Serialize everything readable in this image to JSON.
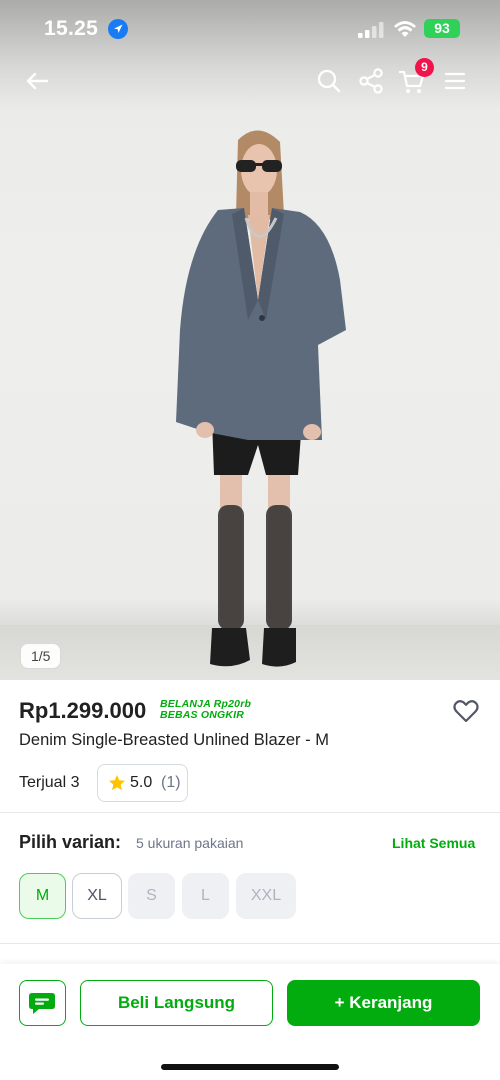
{
  "status_bar": {
    "time": "15.25",
    "battery": "93",
    "icons": [
      "location-arrow-icon",
      "cellular-signal-icon",
      "wifi-icon",
      "battery-icon"
    ]
  },
  "header": {
    "icons": [
      "back-arrow-icon",
      "search-icon",
      "share-icon",
      "cart-icon",
      "menu-icon"
    ],
    "cart_badge": "9"
  },
  "gallery": {
    "counter": "1/5"
  },
  "product": {
    "price": "Rp1.299.000",
    "promo_line1": "BELANJA Rp20rb",
    "promo_line2": "BEBAS ONGKIR",
    "title": "Denim Single-Breasted Unlined Blazer - M",
    "sold": "Terjual 3",
    "rating": "5.0",
    "rating_count": "(1)"
  },
  "variant": {
    "title": "Pilih varian:",
    "subtitle": "5 ukuran pakaian",
    "see_all": "Lihat Semua",
    "options": [
      {
        "label": "M",
        "state": "selected"
      },
      {
        "label": "XL",
        "state": "available"
      },
      {
        "label": "S",
        "state": "disabled"
      },
      {
        "label": "L",
        "state": "disabled"
      },
      {
        "label": "XXL",
        "state": "disabled"
      }
    ]
  },
  "actions": {
    "buy_now": "Beli Langsung",
    "add_to_cart": "+ Keranjang"
  },
  "colors": {
    "brand_green": "#03ac0e",
    "badge_red": "#ef144a",
    "star": "#ffc400"
  }
}
